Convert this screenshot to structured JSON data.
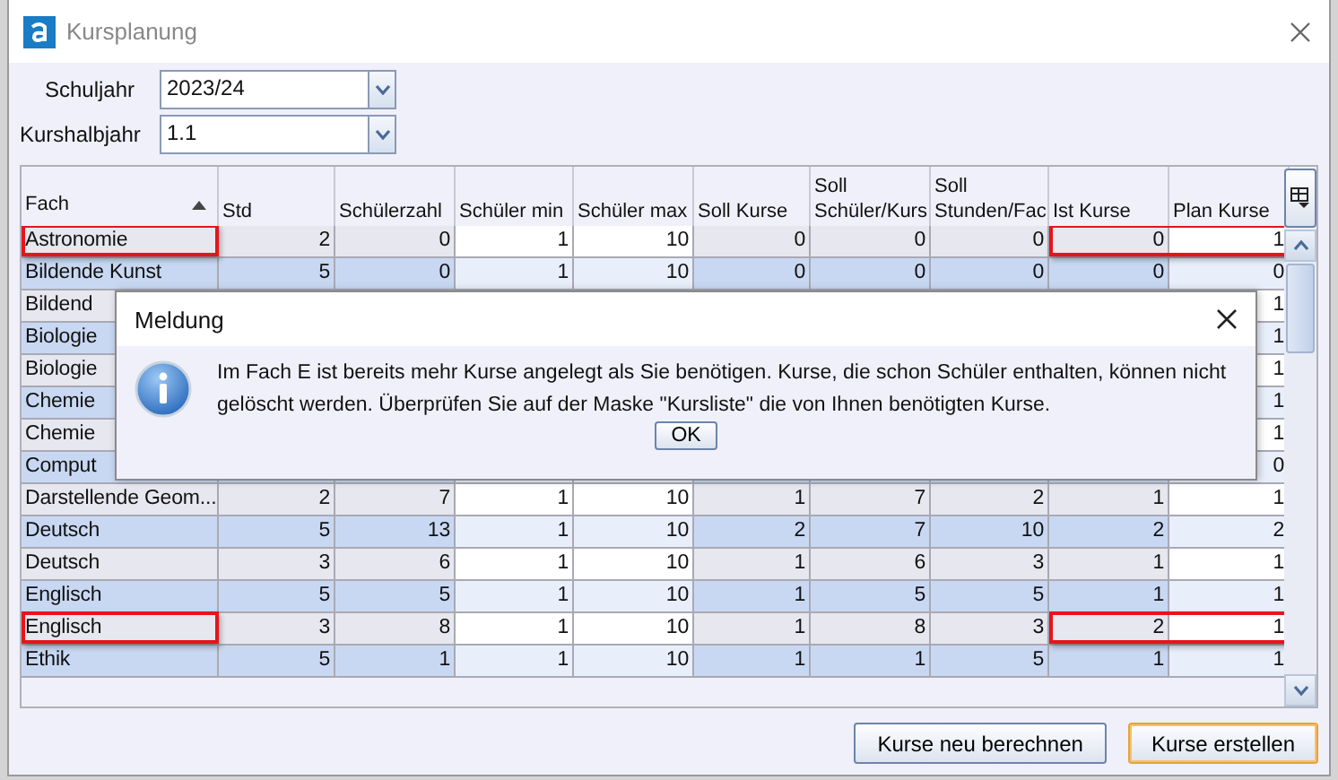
{
  "window": {
    "title": "Kursplanung"
  },
  "filters": [
    {
      "label": "Schuljahr",
      "value": "2023/24"
    },
    {
      "label": "Kurshalbjahr",
      "value": "1.1"
    }
  ],
  "table": {
    "columns": [
      {
        "label": "Fach",
        "editable": false,
        "sorted": true
      },
      {
        "label": "Std",
        "editable": false
      },
      {
        "label": "Schülerzahl",
        "editable": false
      },
      {
        "label": "Schüler min",
        "editable": true
      },
      {
        "label": "Schüler max",
        "editable": true
      },
      {
        "label": "Soll Kurse",
        "editable": false
      },
      {
        "label": "Soll Schüler/Kurs",
        "editable": false
      },
      {
        "label": "Soll Stunden/Fac",
        "editable": false
      },
      {
        "label": "Ist Kurse",
        "editable": false
      },
      {
        "label": "Plan Kurse",
        "editable": true
      }
    ],
    "rows": [
      {
        "fach": "Astronomie",
        "counts": [
          "2",
          "0",
          "1",
          "10",
          "0",
          "0",
          "0",
          "0"
        ],
        "plan": "1",
        "lk": false,
        "marked": true
      },
      {
        "fach": "Bildende Kunst",
        "counts": [
          "5",
          "0",
          "1",
          "10",
          "0",
          "0",
          "0",
          "0"
        ],
        "plan": "0",
        "lk": true,
        "marked": false
      },
      {
        "fach": "Bildend",
        "plan": "1",
        "lk": false,
        "marked": false
      },
      {
        "fach": "Biologie",
        "plan": "1",
        "lk": true,
        "marked": false
      },
      {
        "fach": "Biologie",
        "plan": "1",
        "lk": false,
        "marked": false
      },
      {
        "fach": "Chemie",
        "plan": "1",
        "lk": true,
        "marked": false
      },
      {
        "fach": "Chemie",
        "plan": "1",
        "lk": false,
        "marked": false
      },
      {
        "fach": "Comput",
        "plan": "0",
        "lk": true,
        "marked": false
      },
      {
        "fach": "Darstellende Geom...",
        "counts": [
          "2",
          "7",
          "1",
          "10",
          "1",
          "7",
          "2",
          "1"
        ],
        "plan": "1",
        "lk": false,
        "marked": false
      },
      {
        "fach": "Deutsch",
        "counts": [
          "5",
          "13",
          "1",
          "10",
          "2",
          "7",
          "10",
          "2"
        ],
        "plan": "2",
        "lk": true,
        "marked": false
      },
      {
        "fach": "Deutsch",
        "counts": [
          "3",
          "6",
          "1",
          "10",
          "1",
          "6",
          "3",
          "1"
        ],
        "plan": "1",
        "lk": false,
        "marked": false
      },
      {
        "fach": "Englisch",
        "counts": [
          "5",
          "5",
          "1",
          "10",
          "1",
          "5",
          "5",
          "1"
        ],
        "plan": "1",
        "lk": true,
        "marked": false
      },
      {
        "fach": "Englisch",
        "counts": [
          "3",
          "8",
          "1",
          "10",
          "1",
          "8",
          "3",
          "2"
        ],
        "plan": "1",
        "lk": false,
        "marked": true
      },
      {
        "fach": "Ethik",
        "counts": [
          "5",
          "1",
          "1",
          "10",
          "1",
          "1",
          "5",
          "1"
        ],
        "plan": "1",
        "lk": true,
        "marked": false
      }
    ]
  },
  "dialog": {
    "title": "Meldung",
    "message": "Im Fach E ist  bereits mehr Kurse angelegt als Sie benötigen. Kurse, die schon Schüler enthalten, können nicht gelöscht werden. Überprüfen Sie auf der Maske \"Kursliste\" die von Ihnen benötigten Kurse.",
    "button": "OK"
  },
  "buttons": [
    {
      "label": "Kurse neu berechnen",
      "default": false
    },
    {
      "label": "Kurse erstellen",
      "default": true
    }
  ]
}
